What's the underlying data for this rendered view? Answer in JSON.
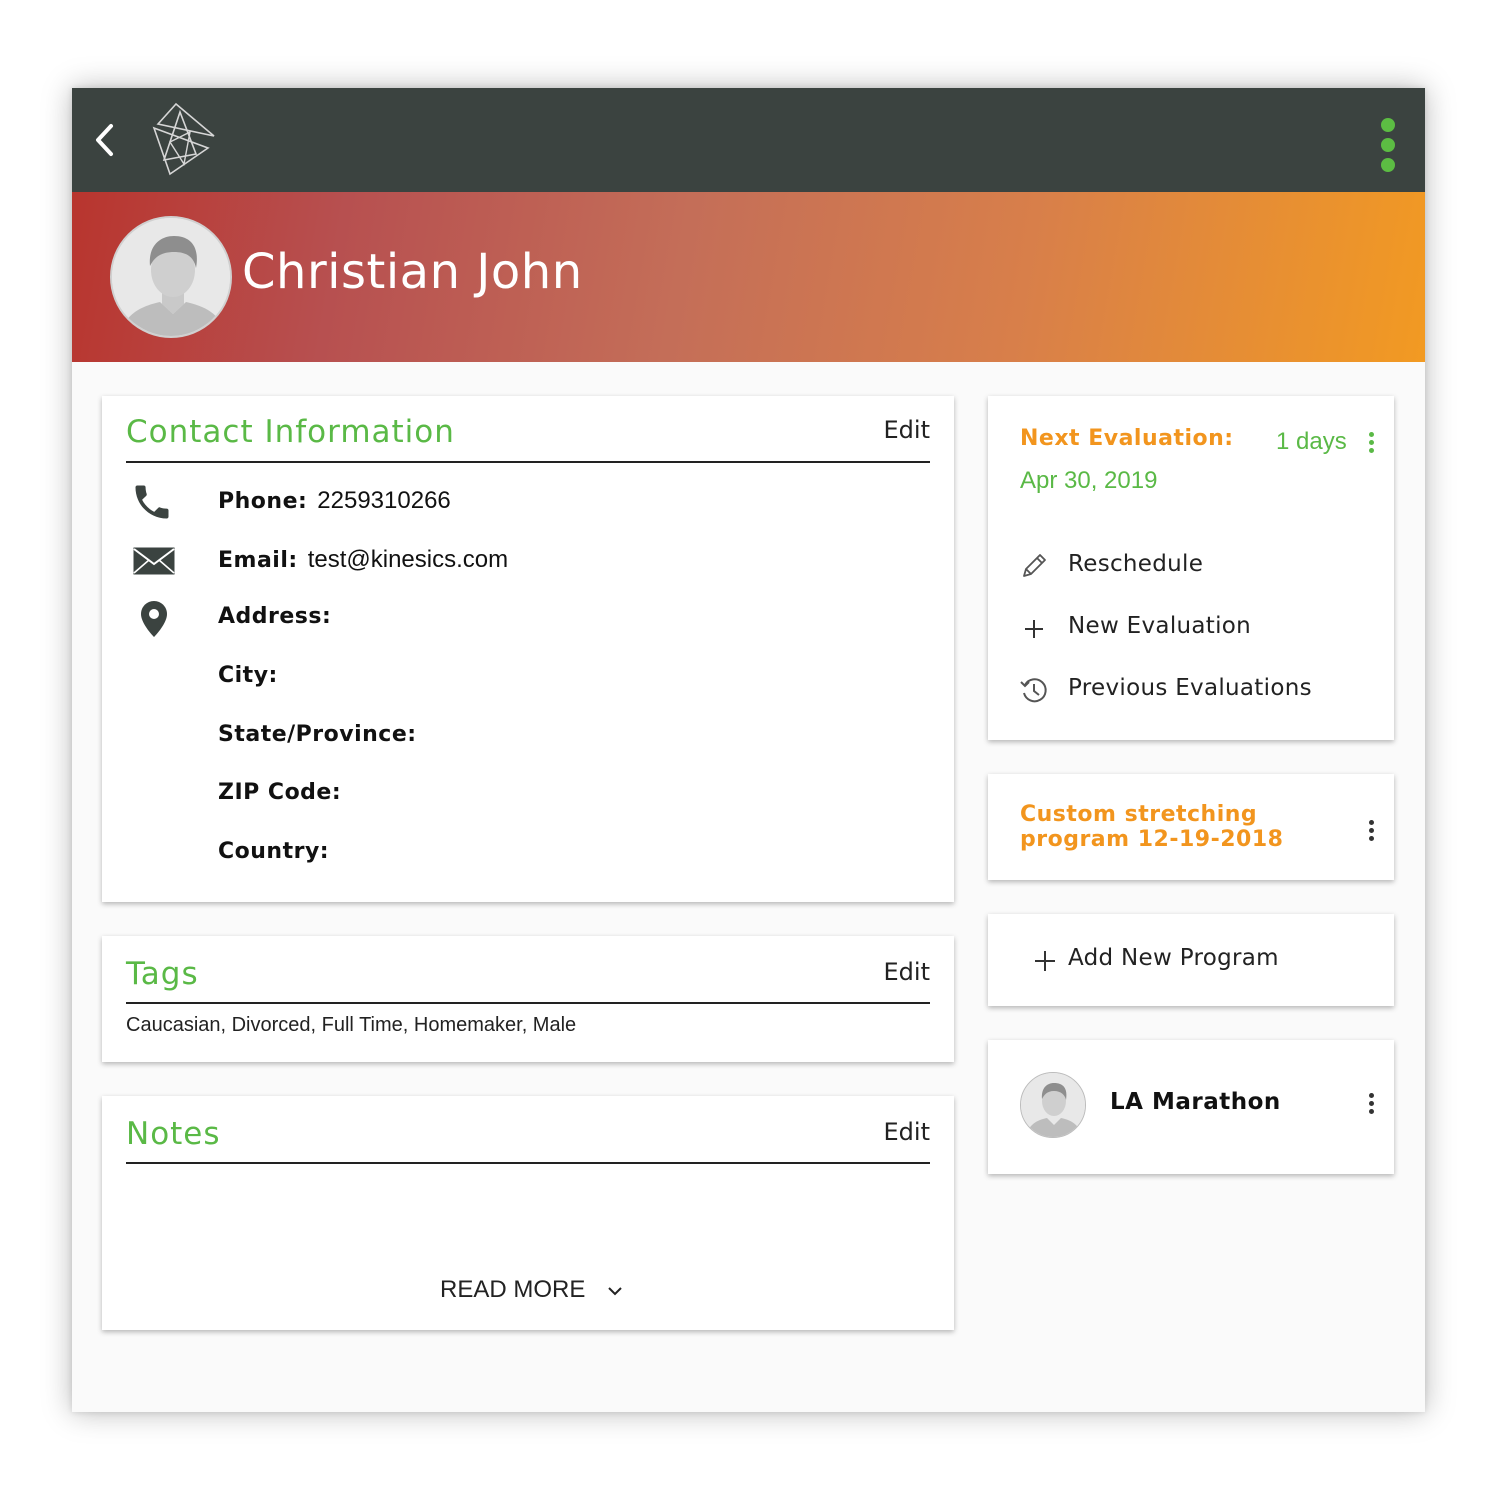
{
  "header": {
    "back_icon": "chevron-left-icon",
    "logo_icon": "triangles-logo-icon",
    "menu_icon": "kebab-menu-icon",
    "menu_color": "#5cbd43"
  },
  "patient": {
    "name": "Christian John",
    "avatar_icon": "user-avatar-icon"
  },
  "contact": {
    "title": "Contact Information",
    "edit_label": "Edit",
    "phone_label": "Phone:",
    "phone_value": "2259310266",
    "email_label": "Email:",
    "email_value": "test@kinesics.com",
    "address_label": "Address:",
    "city_label": "City:",
    "state_label": "State/Province:",
    "zip_label": "ZIP Code:",
    "country_label": "Country:"
  },
  "tags": {
    "title": "Tags",
    "edit_label": "Edit",
    "values": "Caucasian, Divorced, Full Time, Homemaker, Male"
  },
  "notes": {
    "title": "Notes",
    "edit_label": "Edit",
    "read_more_label": "READ MORE"
  },
  "evaluation": {
    "label": "Next Evaluation:",
    "days": "1 days",
    "date": "Apr 30, 2019",
    "actions": [
      {
        "label": "Reschedule",
        "icon": "pencil-icon"
      },
      {
        "label": "New Evaluation",
        "icon": "plus-icon"
      },
      {
        "label": "Previous Evaluations",
        "icon": "history-icon"
      }
    ]
  },
  "program": {
    "title": "Custom stretching program 12-19-2018"
  },
  "add_program": {
    "label": "Add New Program",
    "icon": "plus-icon"
  },
  "goal": {
    "title": "LA Marathon",
    "avatar_icon": "user-avatar-icon"
  },
  "colors": {
    "accent_green": "#5ab946",
    "accent_orange": "#f2951e",
    "topbar": "#3b4340"
  }
}
